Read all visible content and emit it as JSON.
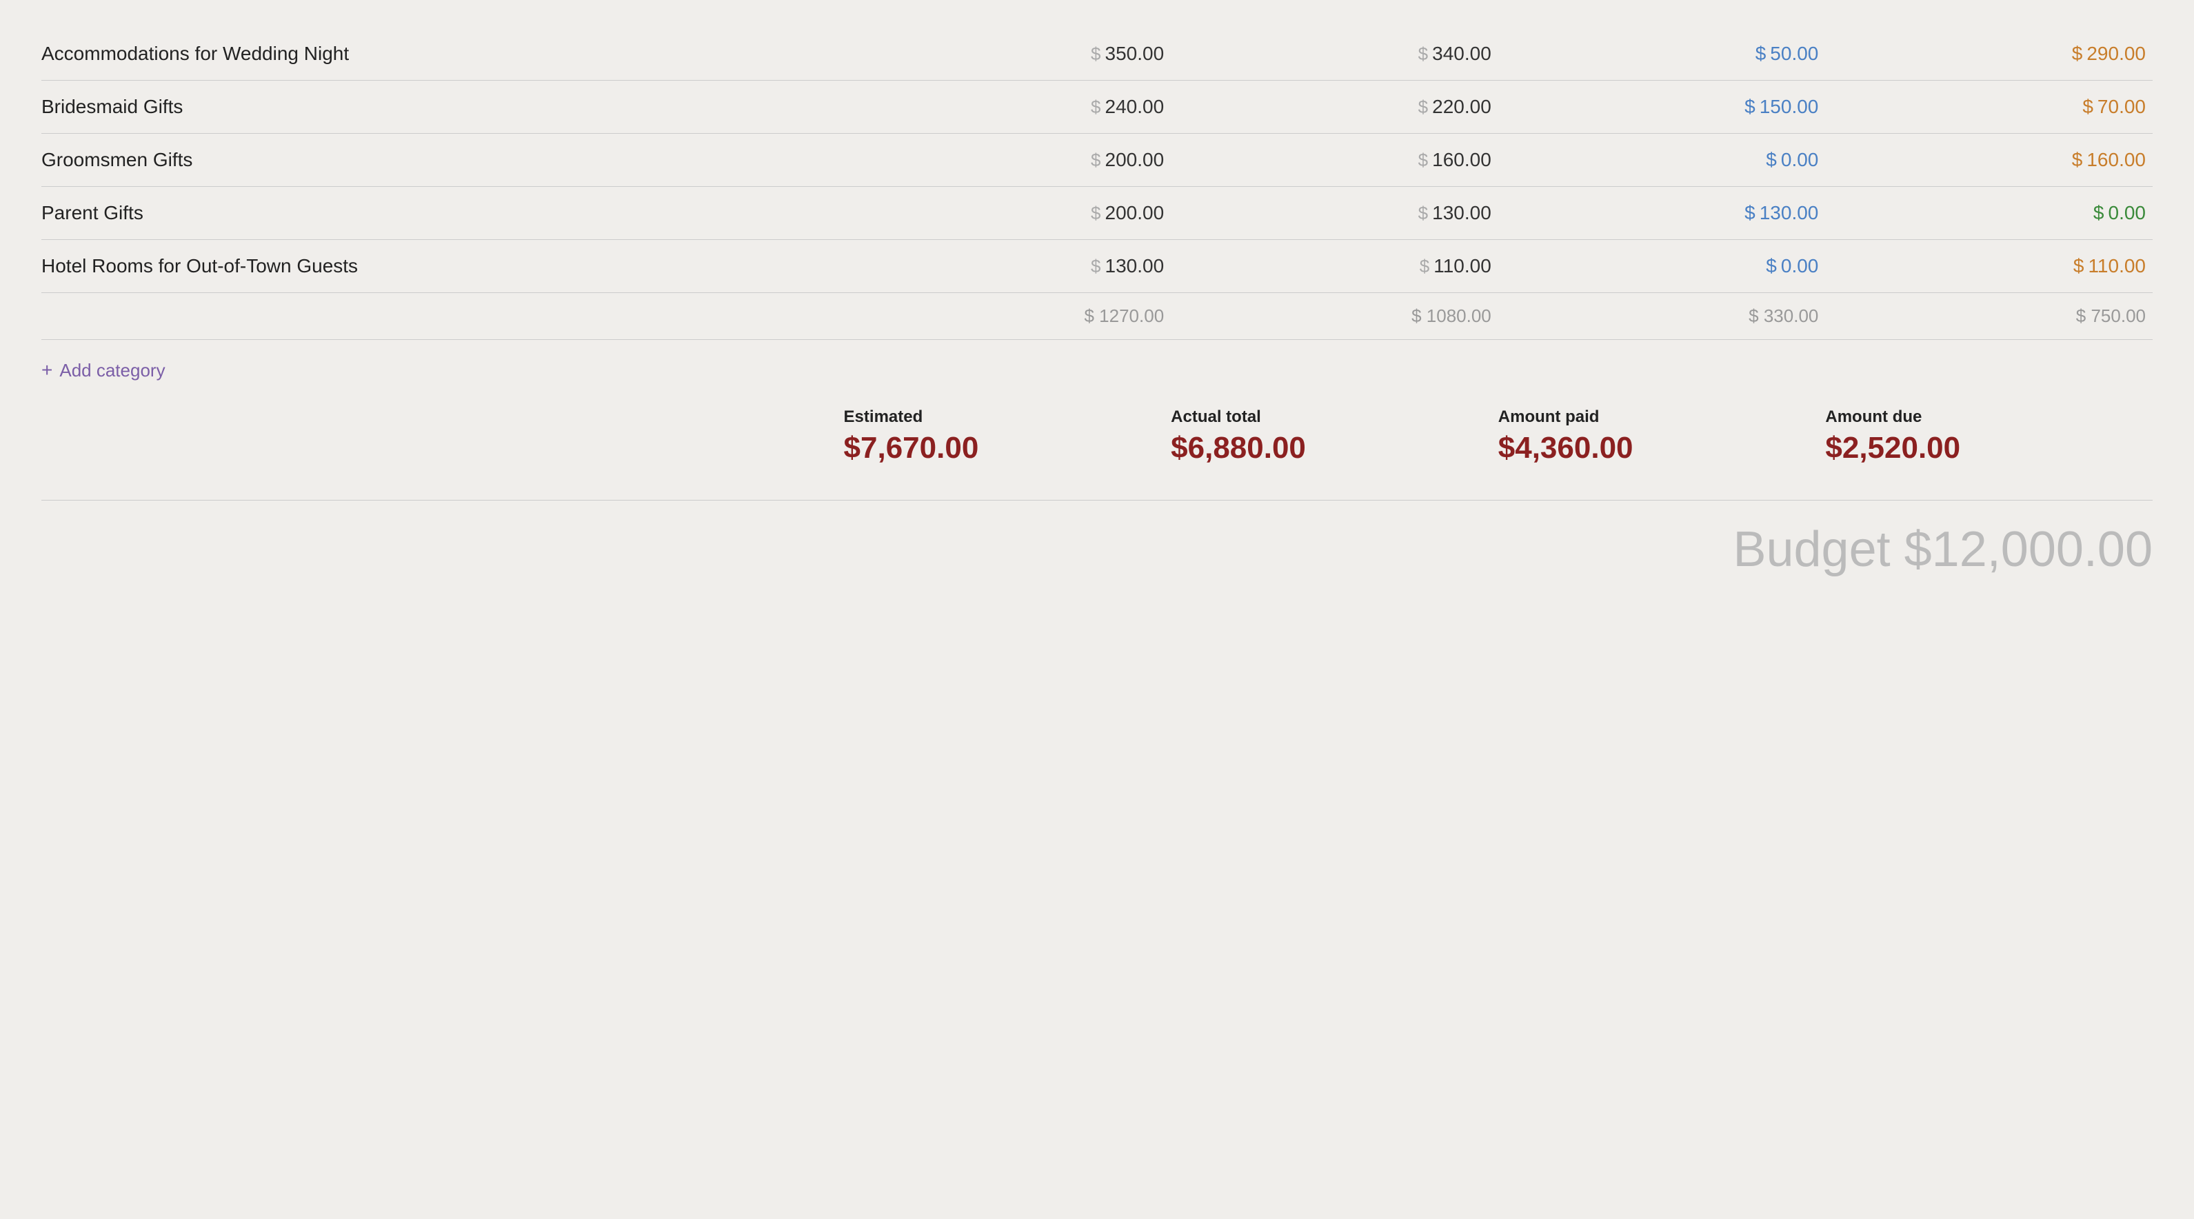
{
  "rows": [
    {
      "name": "Accommodations for Wedding Night",
      "estimated": "350.00",
      "actual": "340.00",
      "paid": "50.00",
      "due": "290.00",
      "paid_color": "blue",
      "due_color": "orange"
    },
    {
      "name": "Bridesmaid Gifts",
      "estimated": "240.00",
      "actual": "220.00",
      "paid": "150.00",
      "due": "70.00",
      "paid_color": "blue",
      "due_color": "orange"
    },
    {
      "name": "Groomsmen Gifts",
      "estimated": "200.00",
      "actual": "160.00",
      "paid": "0.00",
      "due": "160.00",
      "paid_color": "blue",
      "due_color": "orange"
    },
    {
      "name": "Parent Gifts",
      "estimated": "200.00",
      "actual": "130.00",
      "paid": "130.00",
      "due": "0.00",
      "paid_color": "blue",
      "due_color": "green"
    },
    {
      "name": "Hotel Rooms for Out-of-Town Guests",
      "estimated": "130.00",
      "actual": "110.00",
      "paid": "0.00",
      "due": "110.00",
      "paid_color": "blue",
      "due_color": "orange"
    }
  ],
  "subtotals": {
    "estimated": "$ 1270.00",
    "actual": "$ 1080.00",
    "paid": "$ 330.00",
    "due": "$ 750.00"
  },
  "add_category_label": "+ Add category",
  "totals": {
    "estimated_label": "Estimated",
    "estimated_value": "$7,670.00",
    "actual_label": "Actual total",
    "actual_value": "$6,880.00",
    "paid_label": "Amount paid",
    "paid_value": "$4,360.00",
    "due_label": "Amount due",
    "due_value": "$2,520.00"
  },
  "budget_label": "Budget $12,000.00"
}
